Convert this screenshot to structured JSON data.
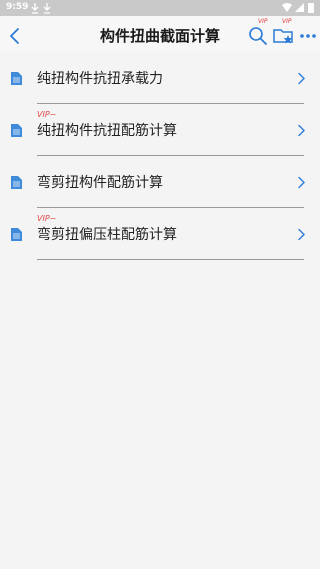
{
  "status_bar": {
    "time": "9:59"
  },
  "app_bar": {
    "title": "构件扭曲截面计算",
    "search_vip": "VIP",
    "folder_vip": "VIP"
  },
  "list": {
    "items": [
      {
        "label": "纯扭构件抗扭承载力",
        "vip": ""
      },
      {
        "label": "纯扭构件抗扭配筋计算",
        "vip": "VIP~"
      },
      {
        "label": "弯剪扭构件配筋计算",
        "vip": ""
      },
      {
        "label": "弯剪扭偏压柱配筋计算",
        "vip": "VIP~"
      }
    ]
  },
  "colors": {
    "accent": "#2b7bd6",
    "vip": "#e04545"
  }
}
